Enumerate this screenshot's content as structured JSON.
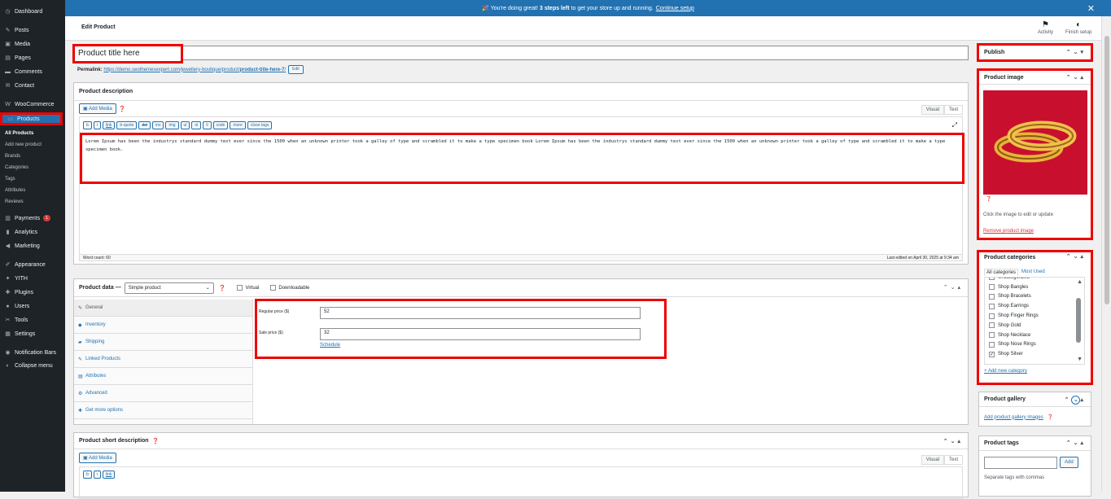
{
  "sidebar": {
    "items": [
      {
        "label": "Dashboard",
        "icon": "dashboard-icon",
        "glyph": "◷"
      },
      {
        "label": "Posts",
        "icon": "pin-icon",
        "glyph": "✎"
      },
      {
        "label": "Media",
        "icon": "media-icon",
        "glyph": "▣"
      },
      {
        "label": "Pages",
        "icon": "pages-icon",
        "glyph": "▤"
      },
      {
        "label": "Comments",
        "icon": "comment-icon",
        "glyph": "▬"
      },
      {
        "label": "Contact",
        "icon": "mail-icon",
        "glyph": "✉"
      },
      {
        "label": "WooCommerce",
        "icon": "woo-icon",
        "glyph": "W"
      },
      {
        "label": "Products",
        "icon": "products-icon",
        "glyph": "▭"
      },
      {
        "label": "Payments",
        "icon": "payments-icon",
        "glyph": "▥",
        "badge": "1"
      },
      {
        "label": "Analytics",
        "icon": "analytics-icon",
        "glyph": "▮"
      },
      {
        "label": "Marketing",
        "icon": "megaphone-icon",
        "glyph": "◀"
      },
      {
        "label": "Appearance",
        "icon": "brush-icon",
        "glyph": "✐"
      },
      {
        "label": "YITH",
        "icon": "yith-icon",
        "glyph": "✦"
      },
      {
        "label": "Plugins",
        "icon": "plugin-icon",
        "glyph": "✚"
      },
      {
        "label": "Users",
        "icon": "user-icon",
        "glyph": "●"
      },
      {
        "label": "Tools",
        "icon": "wrench-icon",
        "glyph": "✂"
      },
      {
        "label": "Settings",
        "icon": "settings-icon",
        "glyph": "▦"
      },
      {
        "label": "Notification Bars",
        "icon": "notification-icon",
        "glyph": "◉"
      },
      {
        "label": "Collapse menu",
        "icon": "collapse-icon",
        "glyph": "◐"
      }
    ],
    "sub": [
      "All Products",
      "Add new product",
      "Brands",
      "Categories",
      "Tags",
      "Attributes",
      "Reviews"
    ]
  },
  "notice": {
    "pre": "🎉 You're doing great!",
    "bold": "3 steps left",
    "post": "to get your store up and running.",
    "link": "Continue setup"
  },
  "header": {
    "title": "Edit Product",
    "activity": "Activity",
    "finish": "Finish setup"
  },
  "title_input": "Product title here",
  "permalink": {
    "label": "Permalink:",
    "url": "https://demo.seothemesexpert.com/jewellery-boutique/product/",
    "slug": "product-title-here-7",
    "suffix": "/",
    "edit": "Edit"
  },
  "description": {
    "title": "Product description",
    "add_media": "Add Media",
    "visual": "Visual",
    "text": "Text",
    "toolbar": [
      "b",
      "i",
      "link",
      "b-quote",
      "del",
      "ins",
      "img",
      "ul",
      "ol",
      "li",
      "code",
      "more",
      "close tags"
    ],
    "content": "Lorem Ipsum has been the industrys standard dummy text ever since the 1500 when an unknown printer took a galley of type and scrambled it to make a type specimen book Lorem Ipsum has been the industrys standard dummy text ever since the 1500 when an unknown printer took a galley of type and scrambled it to make a type specimen book.",
    "word_count": "Word count: 60",
    "last_edited": "Last edited on April 30, 2025 at 9:34 am"
  },
  "product_data": {
    "label": "Product data —",
    "type": "Simple product",
    "virtual": "Virtual",
    "downloadable": "Downloadable",
    "tabs": [
      {
        "label": "General",
        "icon": "wrench-icon",
        "glyph": "✎"
      },
      {
        "label": "Inventory",
        "icon": "inventory-icon",
        "glyph": "◆"
      },
      {
        "label": "Shipping",
        "icon": "truck-icon",
        "glyph": "▰"
      },
      {
        "label": "Linked Products",
        "icon": "link-icon",
        "glyph": "✎"
      },
      {
        "label": "Attributes",
        "icon": "list-icon",
        "glyph": "▤"
      },
      {
        "label": "Advanced",
        "icon": "gear-icon",
        "glyph": "⚙"
      },
      {
        "label": "Get more options",
        "icon": "plugin-icon",
        "glyph": "✚"
      }
    ],
    "regular_label": "Regular price ($)",
    "regular_value": "52",
    "sale_label": "Sale price ($)",
    "sale_value": "32",
    "schedule": "Schedule"
  },
  "short_desc": {
    "title": "Product short description",
    "add_media": "Add Media",
    "visual": "Visual",
    "text": "Text",
    "toolbar": [
      "b",
      "i",
      "link"
    ]
  },
  "publish": {
    "title": "Publish"
  },
  "product_image": {
    "title": "Product image",
    "hint": "Click the image to edit or update",
    "remove": "Remove product image"
  },
  "categories": {
    "title": "Product categories",
    "tab_all": "All categories",
    "tab_used": "Most Used",
    "items": [
      {
        "label": "Uncategorized",
        "checked": false
      },
      {
        "label": "Shop Bangles",
        "checked": false
      },
      {
        "label": "Shop Bracelets",
        "checked": false
      },
      {
        "label": "Shop Earrings",
        "checked": false
      },
      {
        "label": "Shop Finger Rings",
        "checked": false
      },
      {
        "label": "Shop Gold",
        "checked": false
      },
      {
        "label": "Shop Necklace",
        "checked": false
      },
      {
        "label": "Shop Nose Rings",
        "checked": false
      },
      {
        "label": "Shop Silver",
        "checked": true
      }
    ],
    "add": "+ Add new category"
  },
  "gallery": {
    "title": "Product gallery",
    "add": "Add product gallery images"
  },
  "tags": {
    "title": "Product tags",
    "add": "Add",
    "hint": "Separate tags with commas"
  },
  "colors": {
    "accent": "#2271b1",
    "highlight": "#ee0000",
    "image_bg": "#c8102e",
    "sidebar": "#1d2327"
  }
}
